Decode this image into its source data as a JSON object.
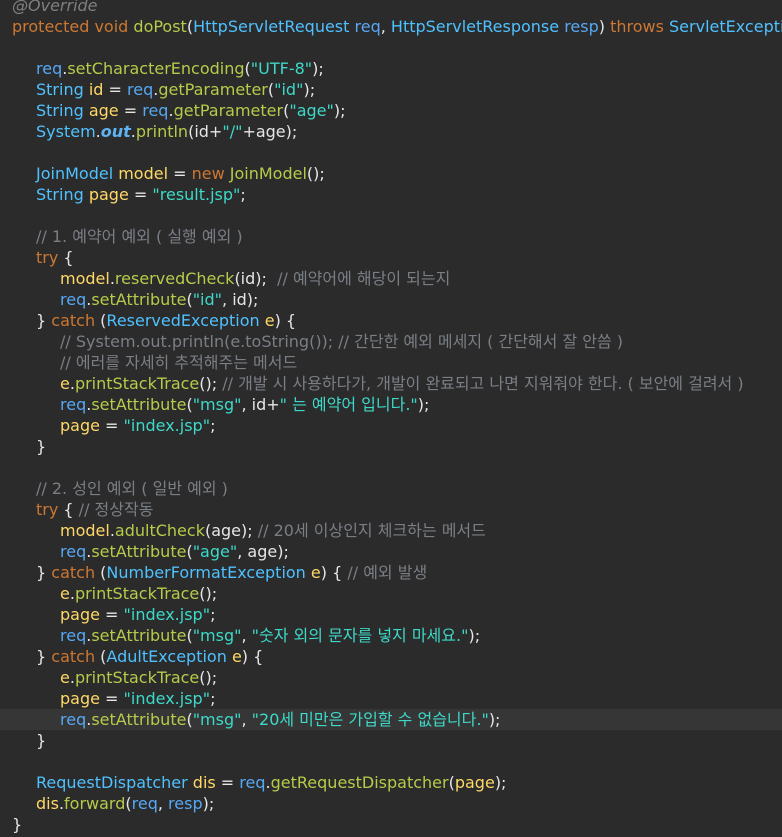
{
  "editor": {
    "lines": [
      {
        "indent": 0,
        "tokens": [
          [
            "ann",
            "@Override"
          ]
        ]
      },
      {
        "indent": 0,
        "tokens": [
          [
            "kw",
            "protected "
          ],
          [
            "kw",
            "void "
          ],
          [
            "meth",
            "doPost"
          ],
          [
            "pun",
            "("
          ],
          [
            "typ",
            "HttpServletRequest "
          ],
          [
            "param",
            "req"
          ],
          [
            "pun",
            ", "
          ],
          [
            "typ",
            "HttpServletResponse "
          ],
          [
            "param",
            "resp"
          ],
          [
            "pun",
            ") "
          ],
          [
            "kw",
            "throws "
          ],
          [
            "typ",
            "ServletException"
          ]
        ]
      },
      {
        "indent": 0,
        "tokens": []
      },
      {
        "indent": 1,
        "tokens": [
          [
            "param",
            "req"
          ],
          [
            "pun",
            "."
          ],
          [
            "meth",
            "setCharacterEncoding"
          ],
          [
            "pun",
            "("
          ],
          [
            "str",
            "\"UTF-8\""
          ],
          [
            "pun",
            ");"
          ]
        ]
      },
      {
        "indent": 1,
        "tokens": [
          [
            "typ",
            "String "
          ],
          [
            "var",
            "id"
          ],
          [
            "pun",
            " = "
          ],
          [
            "param",
            "req"
          ],
          [
            "pun",
            "."
          ],
          [
            "meth",
            "getParameter"
          ],
          [
            "pun",
            "("
          ],
          [
            "str",
            "\"id\""
          ],
          [
            "pun",
            ");"
          ]
        ]
      },
      {
        "indent": 1,
        "tokens": [
          [
            "typ",
            "String "
          ],
          [
            "var",
            "age"
          ],
          [
            "pun",
            " = "
          ],
          [
            "param",
            "req"
          ],
          [
            "pun",
            "."
          ],
          [
            "meth",
            "getParameter"
          ],
          [
            "pun",
            "("
          ],
          [
            "str",
            "\"age\""
          ],
          [
            "pun",
            ");"
          ]
        ]
      },
      {
        "indent": 1,
        "tokens": [
          [
            "typ",
            "System"
          ],
          [
            "pun",
            "."
          ],
          [
            "fld",
            "out"
          ],
          [
            "pun",
            "."
          ],
          [
            "meth",
            "println"
          ],
          [
            "pun",
            "(id+"
          ],
          [
            "str",
            "\"/\""
          ],
          [
            "pun",
            "+age);"
          ]
        ]
      },
      {
        "indent": 0,
        "tokens": []
      },
      {
        "indent": 1,
        "tokens": [
          [
            "typ",
            "JoinModel "
          ],
          [
            "var",
            "model"
          ],
          [
            "pun",
            " = "
          ],
          [
            "kw",
            "new "
          ],
          [
            "meth",
            "JoinModel"
          ],
          [
            "pun",
            "();"
          ]
        ]
      },
      {
        "indent": 1,
        "tokens": [
          [
            "typ",
            "String "
          ],
          [
            "var",
            "page"
          ],
          [
            "pun",
            " = "
          ],
          [
            "str",
            "\"result.jsp\""
          ],
          [
            "pun",
            ";"
          ]
        ]
      },
      {
        "indent": 0,
        "tokens": []
      },
      {
        "indent": 1,
        "tokens": [
          [
            "cmt",
            "// 1. 예약어 예외 ( 실행 예외 )"
          ]
        ]
      },
      {
        "indent": 1,
        "tokens": [
          [
            "kw",
            "try "
          ],
          [
            "pun",
            "{"
          ]
        ]
      },
      {
        "indent": 2,
        "tokens": [
          [
            "var",
            "model"
          ],
          [
            "pun",
            "."
          ],
          [
            "meth",
            "reservedCheck"
          ],
          [
            "pun",
            "(id);  "
          ],
          [
            "cmt",
            "// 예약어에 해당이 되는지"
          ]
        ]
      },
      {
        "indent": 2,
        "tokens": [
          [
            "param",
            "req"
          ],
          [
            "pun",
            "."
          ],
          [
            "meth",
            "setAttribute"
          ],
          [
            "pun",
            "("
          ],
          [
            "str",
            "\"id\""
          ],
          [
            "pun",
            ", id);"
          ]
        ]
      },
      {
        "indent": 1,
        "tokens": [
          [
            "pun",
            "} "
          ],
          [
            "kw",
            "catch "
          ],
          [
            "pun",
            "("
          ],
          [
            "typ",
            "ReservedException "
          ],
          [
            "var",
            "e"
          ],
          [
            "pun",
            ") {"
          ]
        ]
      },
      {
        "indent": 2,
        "tokens": [
          [
            "cmt",
            "// System.out.println(e.toString()); // 간단한 예외 메세지 ( 간단해서 잘 안씀 )"
          ]
        ]
      },
      {
        "indent": 2,
        "tokens": [
          [
            "cmt",
            "// 에러를 자세히 추적해주는 메서드"
          ]
        ]
      },
      {
        "indent": 2,
        "tokens": [
          [
            "var",
            "e"
          ],
          [
            "pun",
            "."
          ],
          [
            "meth",
            "printStackTrace"
          ],
          [
            "pun",
            "(); "
          ],
          [
            "cmt",
            "// 개발 시 사용하다가, 개발이 완료되고 나면 지워줘야 한다. ( 보안에 걸려서 )"
          ]
        ]
      },
      {
        "indent": 2,
        "tokens": [
          [
            "param",
            "req"
          ],
          [
            "pun",
            "."
          ],
          [
            "meth",
            "setAttribute"
          ],
          [
            "pun",
            "("
          ],
          [
            "str",
            "\"msg\""
          ],
          [
            "pun",
            ", id+"
          ],
          [
            "str",
            "\" 는 예약어 입니다.\""
          ],
          [
            "pun",
            ");"
          ]
        ]
      },
      {
        "indent": 2,
        "tokens": [
          [
            "var",
            "page"
          ],
          [
            "pun",
            " = "
          ],
          [
            "str",
            "\"index.jsp\""
          ],
          [
            "pun",
            ";"
          ]
        ]
      },
      {
        "indent": 1,
        "tokens": [
          [
            "pun",
            "}"
          ]
        ]
      },
      {
        "indent": 0,
        "tokens": []
      },
      {
        "indent": 1,
        "tokens": [
          [
            "cmt",
            "// 2. 성인 예외 ( 일반 예외 )"
          ]
        ]
      },
      {
        "indent": 1,
        "tokens": [
          [
            "kw",
            "try "
          ],
          [
            "pun",
            "{ "
          ],
          [
            "cmt",
            "// 정상작동"
          ]
        ]
      },
      {
        "indent": 2,
        "tokens": [
          [
            "var",
            "model"
          ],
          [
            "pun",
            "."
          ],
          [
            "meth",
            "adultCheck"
          ],
          [
            "pun",
            "(age); "
          ],
          [
            "cmt",
            "// 20세 이상인지 체크하는 메서드"
          ]
        ]
      },
      {
        "indent": 2,
        "tokens": [
          [
            "param",
            "req"
          ],
          [
            "pun",
            "."
          ],
          [
            "meth",
            "setAttribute"
          ],
          [
            "pun",
            "("
          ],
          [
            "str",
            "\"age\""
          ],
          [
            "pun",
            ", age);"
          ]
        ]
      },
      {
        "indent": 1,
        "tokens": [
          [
            "pun",
            "} "
          ],
          [
            "kw",
            "catch "
          ],
          [
            "pun",
            "("
          ],
          [
            "typ",
            "NumberFormatException "
          ],
          [
            "var",
            "e"
          ],
          [
            "pun",
            ") { "
          ],
          [
            "cmt",
            "// 예외 발생"
          ]
        ]
      },
      {
        "indent": 2,
        "tokens": [
          [
            "var",
            "e"
          ],
          [
            "pun",
            "."
          ],
          [
            "meth",
            "printStackTrace"
          ],
          [
            "pun",
            "();"
          ]
        ]
      },
      {
        "indent": 2,
        "tokens": [
          [
            "var",
            "page"
          ],
          [
            "pun",
            " = "
          ],
          [
            "str",
            "\"index.jsp\""
          ],
          [
            "pun",
            ";"
          ]
        ]
      },
      {
        "indent": 2,
        "tokens": [
          [
            "param",
            "req"
          ],
          [
            "pun",
            "."
          ],
          [
            "meth",
            "setAttribute"
          ],
          [
            "pun",
            "("
          ],
          [
            "str",
            "\"msg\""
          ],
          [
            "pun",
            ", "
          ],
          [
            "str",
            "\"숫자 외의 문자를 넣지 마세요.\""
          ],
          [
            "pun",
            ");"
          ]
        ]
      },
      {
        "indent": 1,
        "tokens": [
          [
            "pun",
            "} "
          ],
          [
            "kw",
            "catch "
          ],
          [
            "pun",
            "("
          ],
          [
            "typ",
            "AdultException "
          ],
          [
            "var",
            "e"
          ],
          [
            "pun",
            ") {"
          ]
        ]
      },
      {
        "indent": 2,
        "tokens": [
          [
            "var",
            "e"
          ],
          [
            "pun",
            "."
          ],
          [
            "meth",
            "printStackTrace"
          ],
          [
            "pun",
            "();"
          ]
        ]
      },
      {
        "indent": 2,
        "tokens": [
          [
            "var",
            "page"
          ],
          [
            "pun",
            " = "
          ],
          [
            "str",
            "\"index.jsp\""
          ],
          [
            "pun",
            ";"
          ]
        ]
      },
      {
        "indent": 2,
        "highlight": true,
        "tokens": [
          [
            "param",
            "req"
          ],
          [
            "pun",
            "."
          ],
          [
            "meth",
            "setAttribute"
          ],
          [
            "pun",
            "("
          ],
          [
            "str",
            "\"msg\""
          ],
          [
            "pun",
            ", "
          ],
          [
            "str",
            "\"20세 미만은 가입할 수 없습니다.\""
          ],
          [
            "pun",
            ");"
          ]
        ]
      },
      {
        "indent": 1,
        "tokens": [
          [
            "pun",
            "}"
          ]
        ]
      },
      {
        "indent": 0,
        "tokens": []
      },
      {
        "indent": 1,
        "tokens": [
          [
            "typ",
            "RequestDispatcher "
          ],
          [
            "var",
            "dis"
          ],
          [
            "pun",
            " = "
          ],
          [
            "param",
            "req"
          ],
          [
            "pun",
            "."
          ],
          [
            "meth",
            "getRequestDispatcher"
          ],
          [
            "pun",
            "("
          ],
          [
            "var",
            "page"
          ],
          [
            "pun",
            ");"
          ]
        ]
      },
      {
        "indent": 1,
        "tokens": [
          [
            "var",
            "dis"
          ],
          [
            "pun",
            "."
          ],
          [
            "meth",
            "forward"
          ],
          [
            "pun",
            "("
          ],
          [
            "param",
            "req"
          ],
          [
            "pun",
            ", "
          ],
          [
            "param",
            "resp"
          ],
          [
            "pun",
            ");"
          ]
        ]
      },
      {
        "indent": 0,
        "tokens": [
          [
            "pun",
            "}"
          ]
        ]
      }
    ]
  }
}
